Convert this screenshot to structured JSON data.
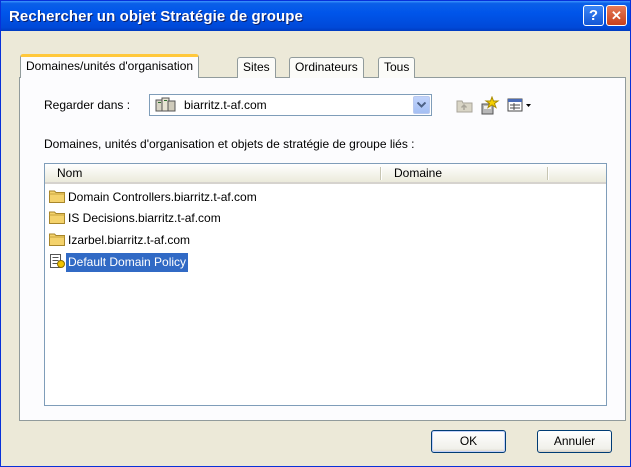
{
  "window": {
    "title": "Rechercher un objet Stratégie de groupe",
    "help_label": "?",
    "close_label": "✕"
  },
  "tabs": [
    {
      "label": "Domaines/unités d'organisation",
      "active": true
    },
    {
      "label": "Sites",
      "active": false
    },
    {
      "label": "Ordinateurs",
      "active": false
    },
    {
      "label": "Tous",
      "active": false
    }
  ],
  "look_in": {
    "label": "Regarder dans :",
    "value": "biarritz.t-af.com",
    "icon": "domain-icon"
  },
  "toolbar_icons": [
    "up-folder-icon",
    "new-gpo-icon",
    "view-menu-icon"
  ],
  "list": {
    "caption": "Domaines, unités d'organisation et objets de stratégie de groupe liés :",
    "columns": [
      "Nom",
      "Domaine"
    ],
    "rows": [
      {
        "name": "Domain Controllers.biarritz.t-af.com",
        "domain": "",
        "icon": "folder-icon",
        "selected": false
      },
      {
        "name": "IS Decisions.biarritz.t-af.com",
        "domain": "",
        "icon": "folder-icon",
        "selected": false
      },
      {
        "name": "Izarbel.biarritz.t-af.com",
        "domain": "",
        "icon": "folder-icon",
        "selected": false
      },
      {
        "name": "Default Domain Policy",
        "domain": "",
        "icon": "gpo-icon",
        "selected": true
      }
    ]
  },
  "buttons": {
    "ok": "OK",
    "cancel": "Annuler"
  },
  "colors": {
    "titlebar": "#0055ea",
    "dialog_bg": "#ece9d8",
    "selection": "#316ac5",
    "active_tab_accent": "#ffc83c"
  }
}
